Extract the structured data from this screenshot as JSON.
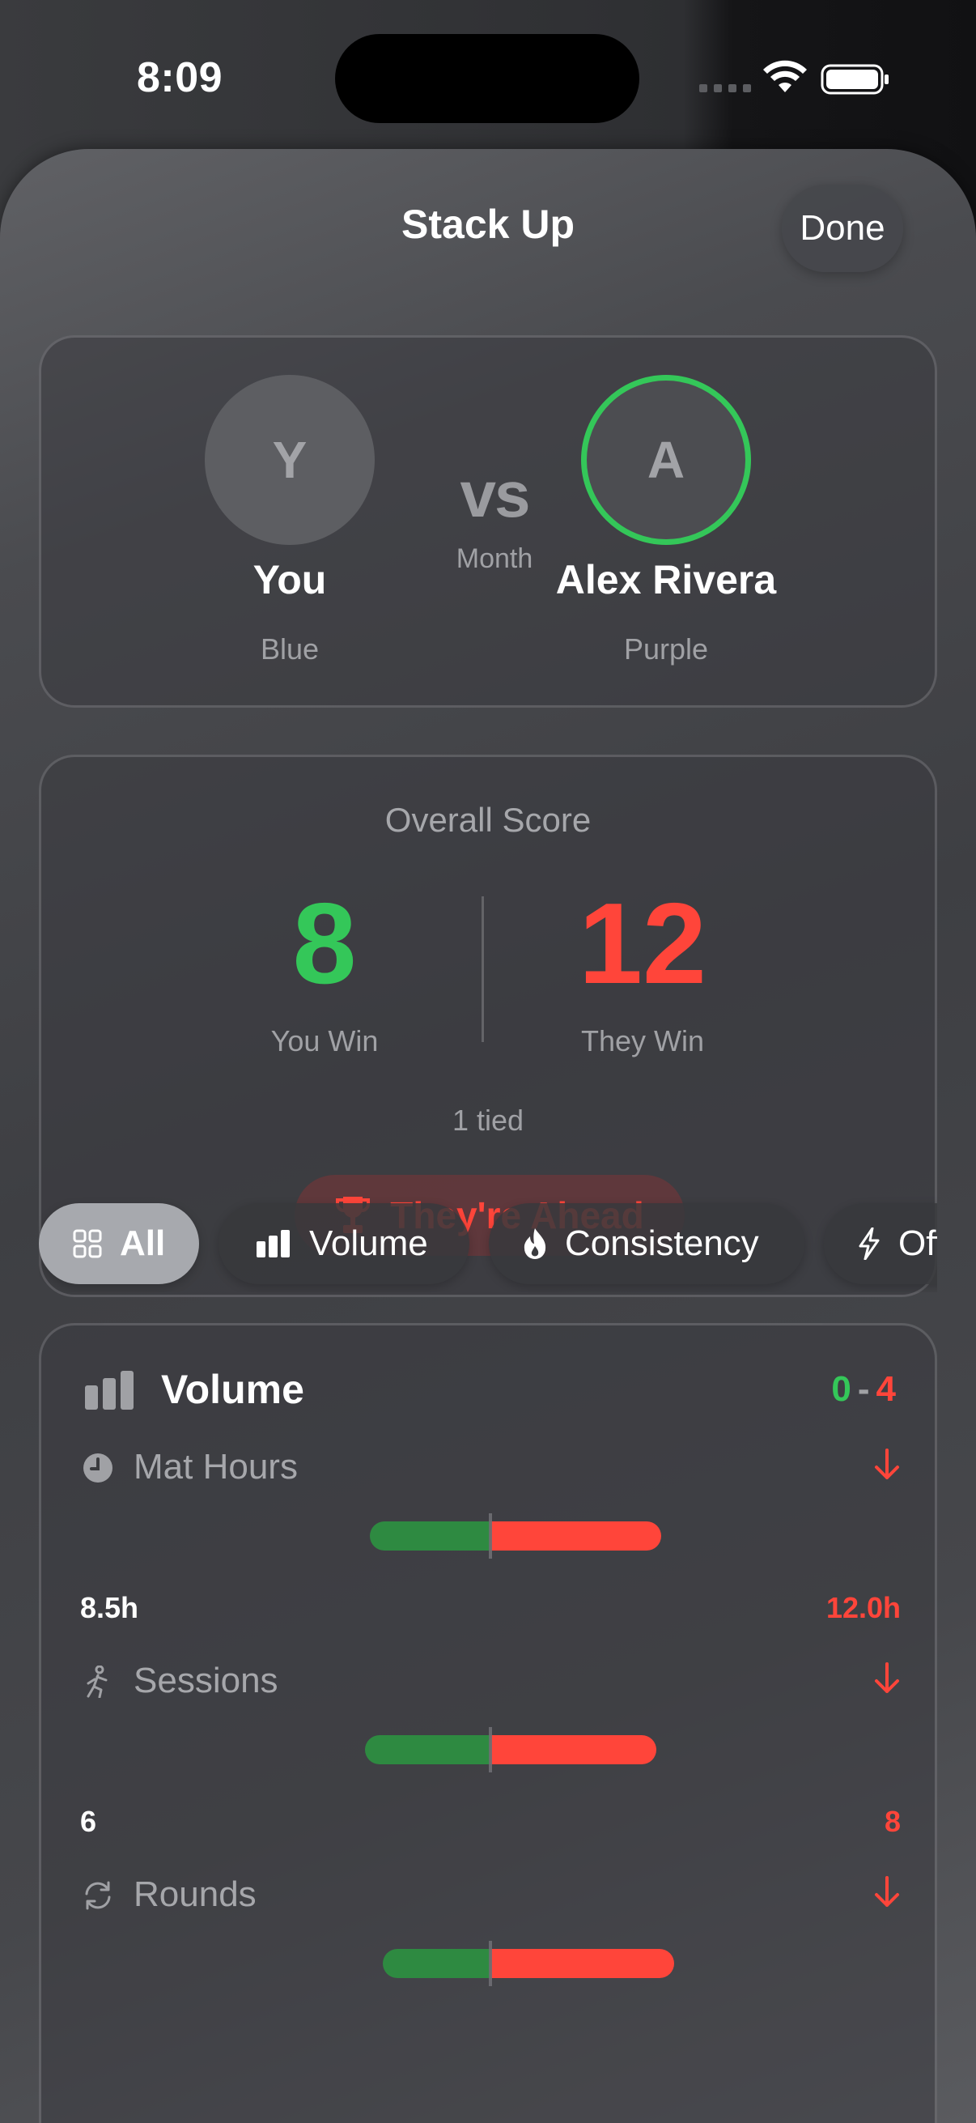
{
  "status_bar": {
    "time": "8:09"
  },
  "sheet": {
    "title": "Stack Up",
    "done_label": "Done"
  },
  "matchup": {
    "you": {
      "initial": "Y",
      "name": "You",
      "subtitle": "Blue"
    },
    "vs_label": "vs",
    "period": "Month",
    "opponent": {
      "initial": "A",
      "name": "Alex Rivera",
      "subtitle": "Purple"
    }
  },
  "overall": {
    "title": "Overall Score",
    "you_score": "8",
    "you_label": "You Win",
    "them_score": "12",
    "them_label": "They Win",
    "tied": "1 tied",
    "status": "They're Ahead"
  },
  "filters": [
    {
      "label": "All",
      "icon": "grid-icon",
      "selected": true
    },
    {
      "label": "Volume",
      "icon": "bar-chart-icon",
      "selected": false
    },
    {
      "label": "Consistency",
      "icon": "flame-icon",
      "selected": false
    },
    {
      "label": "Offense",
      "icon": "bolt-icon",
      "selected": false
    }
  ],
  "volume": {
    "title": "Volume",
    "score_you": "0",
    "score_dash": "-",
    "score_them": "4",
    "metrics": [
      {
        "label": "Mat Hours",
        "icon": "clock-icon",
        "you_value": "8.5h",
        "them_value": "12.0h",
        "you_share": 0.415,
        "them_share": 0.585
      },
      {
        "label": "Sessions",
        "icon": "figure-icon",
        "you_value": "6",
        "them_value": "8",
        "you_share": 0.43,
        "them_share": 0.57
      },
      {
        "label": "Rounds",
        "icon": "refresh-icon",
        "you_value": "",
        "them_value": "",
        "you_share": 0.37,
        "them_share": 0.63
      }
    ]
  },
  "colors": {
    "win": "#34c759",
    "loss": "#ff453a",
    "you_bar": "#2e8a41"
  }
}
